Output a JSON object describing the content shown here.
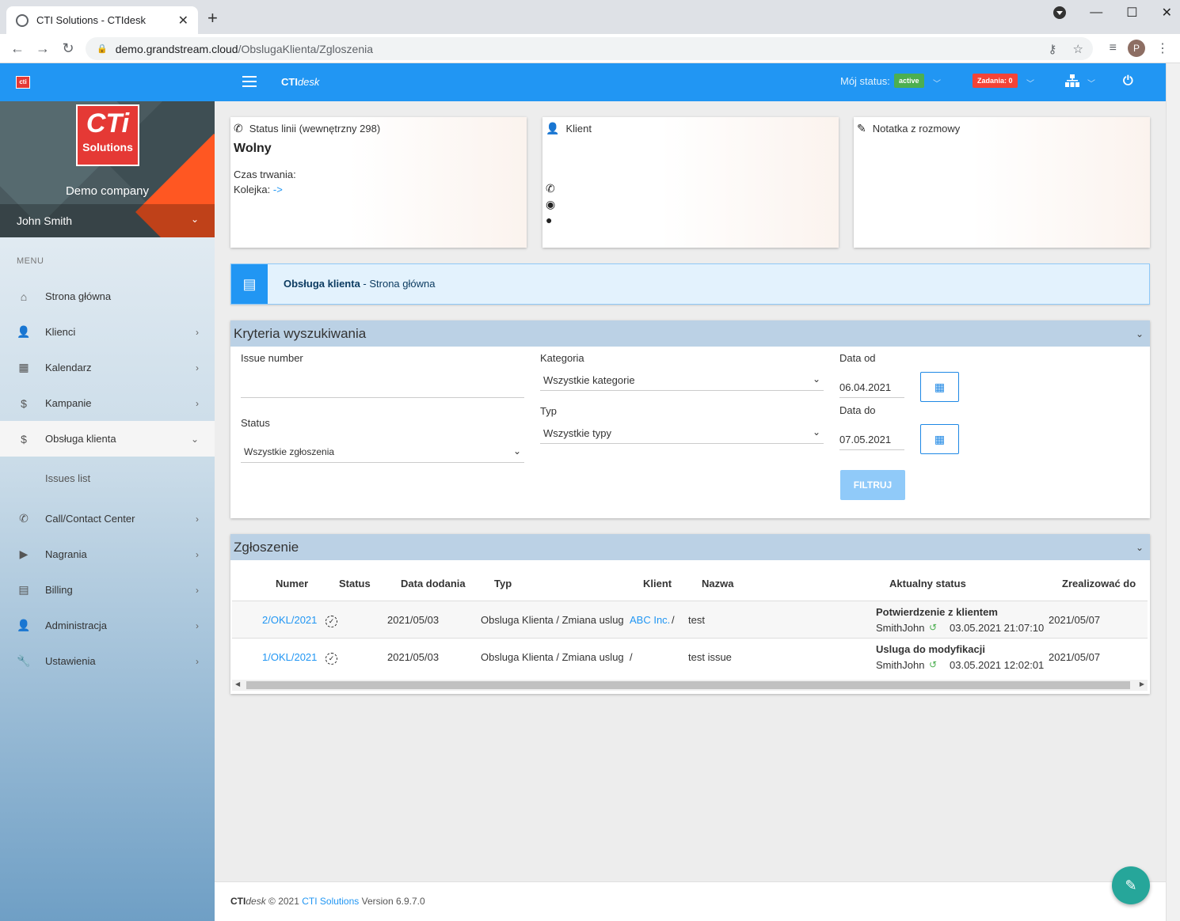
{
  "browser": {
    "tab_title": "CTI Solutions - CTIdesk",
    "url_host": "demo.grandstream.cloud",
    "url_path": "/ObslugaKlienta/Zgloszenia",
    "profile_initial": "P"
  },
  "header": {
    "brand_bold": "CTI",
    "brand_italic": "desk",
    "status_label": "Mój status:",
    "status_value": "active",
    "tasks_label": "Zadania: 0"
  },
  "sidebar": {
    "logo_main": "CTi",
    "logo_sub": "Solutions",
    "company": "Demo company",
    "user": "John Smith",
    "menu_heading": "MENU",
    "items": [
      {
        "label": "Strona główna"
      },
      {
        "label": "Klienci"
      },
      {
        "label": "Kalendarz"
      },
      {
        "label": "Kampanie"
      },
      {
        "label": "Obsługa klienta"
      },
      {
        "label": "Call/Contact Center"
      },
      {
        "label": "Nagrania"
      },
      {
        "label": "Billing"
      },
      {
        "label": "Administracja"
      },
      {
        "label": "Ustawienia"
      }
    ],
    "sub_item": "Issues list"
  },
  "line_status": {
    "title": "Status linii (wewnętrzny 298)",
    "state": "Wolny",
    "duration_label": "Czas trwania:",
    "queue_label": "Kolejka:",
    "queue_value": "->"
  },
  "client_card": {
    "title": "Klient"
  },
  "note_card": {
    "title": "Notatka z rozmowy"
  },
  "banner": {
    "bold": "Obsługa klienta",
    "rest": " - Strona główna"
  },
  "search": {
    "title": "Kryteria wyszukiwania",
    "issue_label": "Issue number",
    "status_label": "Status",
    "status_value": "Wszystkie zgłoszenia",
    "category_label": "Kategoria",
    "category_value": "Wszystkie kategorie",
    "type_label": "Typ",
    "type_value": "Wszystkie typy",
    "date_from_label": "Data od",
    "date_from": "06.04.2021",
    "date_to_label": "Data do",
    "date_to": "07.05.2021",
    "filter_button": "FILTRUJ"
  },
  "issues": {
    "title": "Zgłoszenie",
    "columns": [
      "Numer",
      "Status",
      "Data dodania",
      "Typ",
      "Klient",
      "Nazwa",
      "Aktualny status",
      "Zrealizować do"
    ],
    "rows": [
      {
        "number": "2/OKL/2021",
        "date": "2021/05/03",
        "type": "Obsluga Klienta / Zmiana uslug",
        "client": "ABC Inc.",
        "client_sep": "/",
        "name": "test",
        "status_title": "Potwierdzenie z klientem",
        "status_user": "SmithJohn",
        "status_time": "03.05.2021 21:07:10",
        "due": "2021/05/07"
      },
      {
        "number": "1/OKL/2021",
        "date": "2021/05/03",
        "type": "Obsluga Klienta / Zmiana uslug",
        "client": "",
        "client_sep": "/",
        "name": "test issue",
        "status_title": "Usluga do modyfikacji",
        "status_user": "SmithJohn",
        "status_time": "03.05.2021 12:02:01",
        "due": "2021/05/07"
      }
    ]
  },
  "footer": {
    "brand_bold": "CTI",
    "brand_italic": "desk",
    "copyright": " © 2021 ",
    "company_link": "CTI Solutions",
    "version": " Version 6.9.7.0"
  },
  "colors": {
    "header_blue": "#2196f3",
    "active_green": "#4caf50",
    "tasks_red": "#f44336",
    "fab_teal": "#26a69a",
    "logo_red": "#e53935"
  }
}
